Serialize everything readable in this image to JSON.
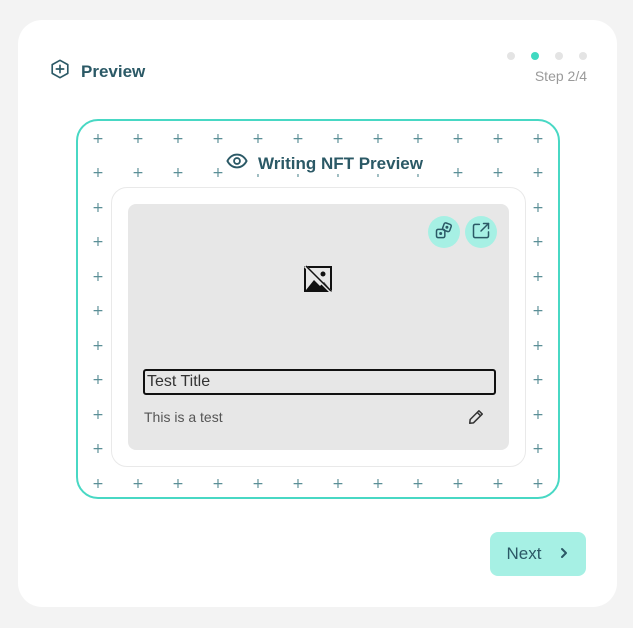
{
  "header": {
    "title": "Preview",
    "icon": "plus-hexagon-icon"
  },
  "steps": {
    "total": 4,
    "current": 2,
    "label": "Step 2/4"
  },
  "preview": {
    "title": "Writing NFT Preview",
    "icon": "eye-icon"
  },
  "nft": {
    "title_value": "Test Title",
    "description": "This is a test",
    "actions": [
      "dice-icon",
      "share-icon"
    ],
    "image_icon": "image-off-icon",
    "edit_icon": "pencil-icon"
  },
  "footer": {
    "next_label": "Next",
    "next_icon": "chevron-right-icon"
  },
  "colors": {
    "accent": "#40d9c1",
    "accent_light": "#a6f0e4",
    "text_primary": "#2b5966"
  }
}
